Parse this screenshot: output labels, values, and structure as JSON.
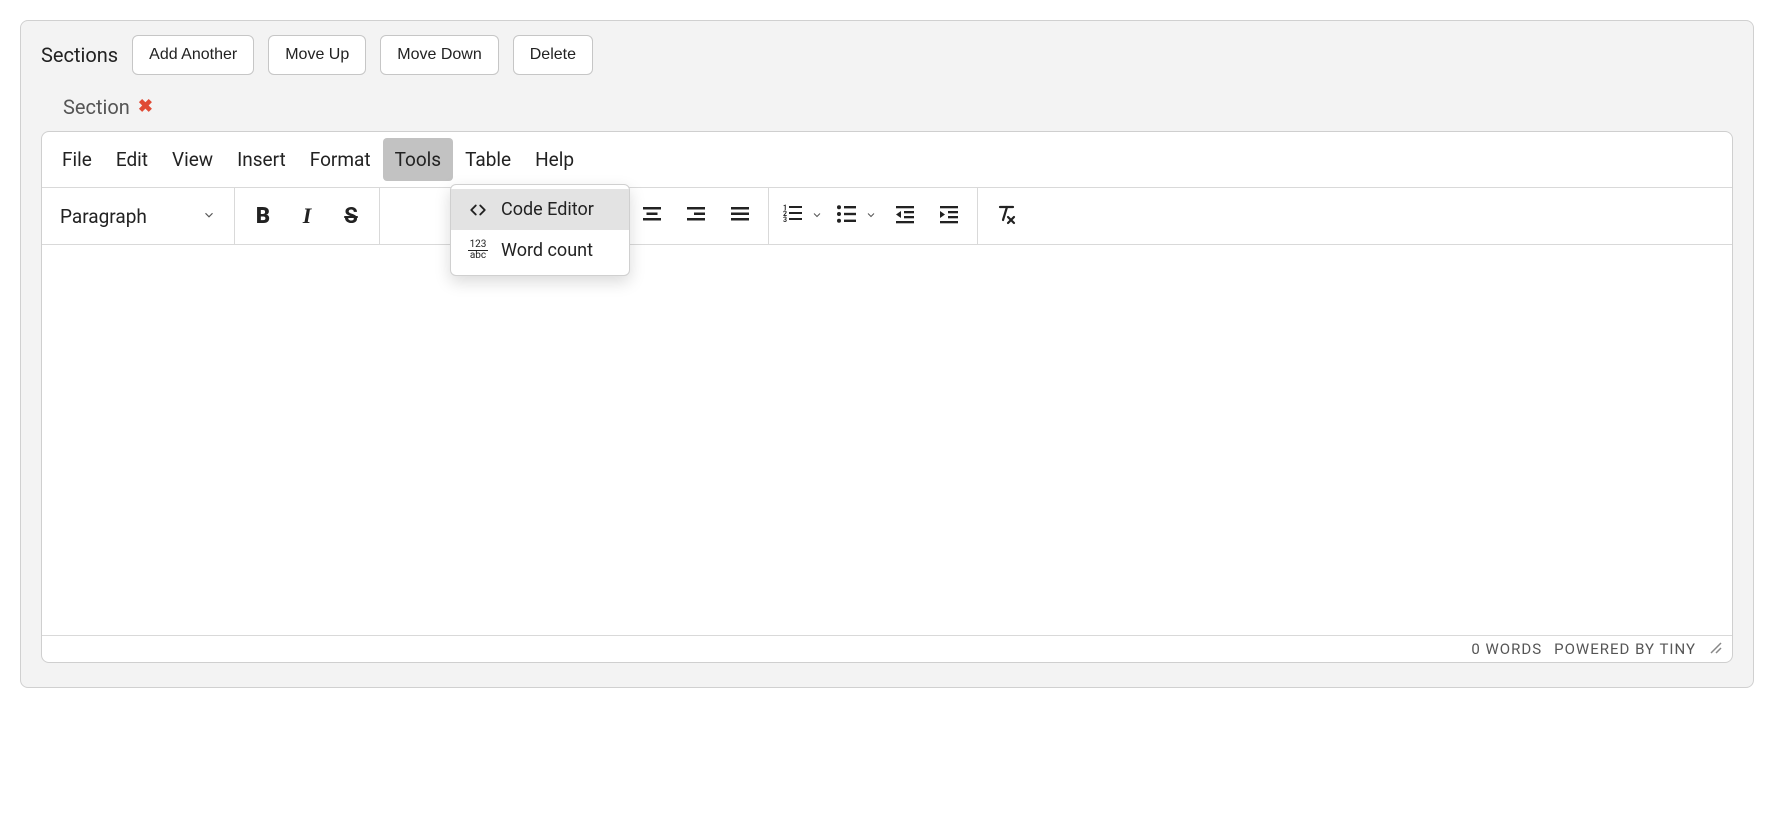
{
  "header": {
    "label": "Sections",
    "buttons": {
      "add": "Add Another",
      "up": "Move Up",
      "down": "Move Down",
      "delete": "Delete"
    }
  },
  "section": {
    "title": "Section"
  },
  "editor": {
    "menubar": {
      "file": "File",
      "edit": "Edit",
      "view": "View",
      "insert": "Insert",
      "format": "Format",
      "tools": "Tools",
      "table": "Table",
      "help": "Help"
    },
    "tools_dropdown": {
      "code_editor": "Code Editor",
      "word_count": "Word count"
    },
    "toolbar": {
      "block_format": "Paragraph"
    },
    "statusbar": {
      "word_count": "0 WORDS",
      "branding": "POWERED BY TINY"
    }
  }
}
